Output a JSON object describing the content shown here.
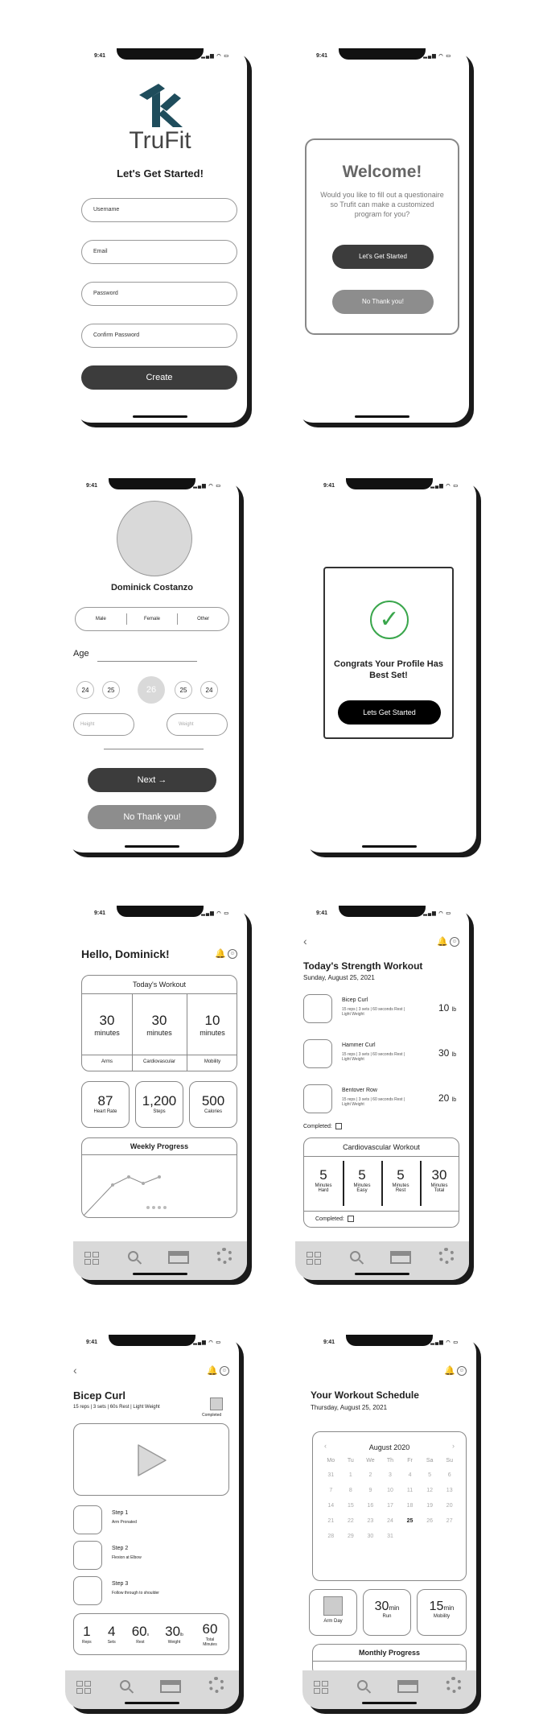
{
  "status": {
    "time": "9:41"
  },
  "screen1": {
    "brand": "TruFit",
    "heading": "Let's Get Started!",
    "fields": [
      "Username",
      "Email",
      "Password",
      "Confirm Password"
    ],
    "create": "Create",
    "logo_color": "#1f4d5c"
  },
  "screen2": {
    "title": "Welcome!",
    "body": "Would you like to fill out a questionaire so Trufit can make a customized program for you?",
    "primary": "Let's Get Started",
    "secondary": "No Thank you!"
  },
  "screen3": {
    "name": "Dominick Costanzo",
    "genders": [
      "Male",
      "Female",
      "Other"
    ],
    "age_label": "Age",
    "ages": [
      "24",
      "25",
      "26",
      "25",
      "24"
    ],
    "height": "Height",
    "weight": "Weight",
    "next": "Next",
    "next_arrow": "→",
    "no_thanks": "No Thank you!"
  },
  "screen4": {
    "title": "Congrats Your Profile Has Best Set!",
    "button": "Lets Get Started",
    "check": "✓",
    "accent": "#3aa64c"
  },
  "screen5": {
    "greeting": "Hello, Dominick!",
    "workout_title": "Today's Workout",
    "workouts": [
      {
        "num": "30",
        "unit": "minutes",
        "label": "Arms"
      },
      {
        "num": "30",
        "unit": "minutes",
        "label": "Cardiovascular"
      },
      {
        "num": "10",
        "unit": "minutes",
        "label": "Mobility"
      }
    ],
    "stats": [
      {
        "num": "87",
        "label": "Heart Rate"
      },
      {
        "num": "1,200",
        "label": "Steps"
      },
      {
        "num": "500",
        "label": "Calories"
      }
    ],
    "progress_title": "Weekly Progress"
  },
  "screen6": {
    "title": "Today's Strength Workout",
    "date": "Sunday, August 25, 2021",
    "exercises": [
      {
        "name": "Bicep Curl",
        "detail": "15 reps | 3 sets | 60 seconds Rest | Light Weight",
        "weight": "10",
        "unit": "lb"
      },
      {
        "name": "Hammer Curl",
        "detail": "15 reps | 3 sets | 60 seconds Rest | Light Weight",
        "weight": "30",
        "unit": "lb"
      },
      {
        "name": "Bentover Row",
        "detail": "15 reps | 3 sets | 60 seconds Rest | Light Weight",
        "weight": "20",
        "unit": "lb"
      }
    ],
    "completed": "Completed:",
    "cardio_title": "Cardiovascular Workout",
    "cardio": [
      {
        "num": "5",
        "unit": "Minutes",
        "label": "Hard"
      },
      {
        "num": "5",
        "unit": "Minutes",
        "label": "Easy"
      },
      {
        "num": "5",
        "unit": "Minutes",
        "label": "Rest"
      },
      {
        "num": "30",
        "unit": "Minutes",
        "label": "Total"
      }
    ],
    "completed2": "Completed:"
  },
  "screen7": {
    "title": "Bicep Curl",
    "detail": "15 reps | 3 sets | 60s Rest | Light Weight",
    "completed": "Completed",
    "steps": [
      {
        "title": "Step 1",
        "desc": "Arm Pronated"
      },
      {
        "title": "Step 2",
        "desc": "Flexion at Elbow"
      },
      {
        "title": "Step 3",
        "desc": "Follow through to shoulder"
      }
    ],
    "summary": [
      {
        "num": "1",
        "label": "Reps"
      },
      {
        "num": "4",
        "label": "Sets"
      },
      {
        "num": "60",
        "suffix": "s",
        "label": "Rest"
      },
      {
        "num": "30",
        "suffix": "lb",
        "label": "Weight"
      },
      {
        "num": "60",
        "label": "Total Minutes"
      }
    ]
  },
  "screen8": {
    "title": "Your Workout Schedule",
    "date": "Thursday, August 25, 2021",
    "month": "August 2020",
    "weekdays": [
      "Mo",
      "Tu",
      "We",
      "Th",
      "Fr",
      "Sa",
      "Su"
    ],
    "days": [
      "31",
      "1",
      "2",
      "3",
      "4",
      "5",
      "6",
      "7",
      "8",
      "9",
      "10",
      "11",
      "12",
      "13",
      "14",
      "15",
      "16",
      "17",
      "18",
      "19",
      "20",
      "21",
      "22",
      "23",
      "24",
      "25",
      "26",
      "27",
      "28",
      "29",
      "30",
      "31"
    ],
    "selected": "25",
    "cards": [
      {
        "label": "Arm Day"
      },
      {
        "num": "30",
        "unit": "min",
        "label": "Run"
      },
      {
        "num": "15",
        "unit": "min",
        "label": "Mobility"
      }
    ],
    "progress_title": "Monthly Progress"
  }
}
